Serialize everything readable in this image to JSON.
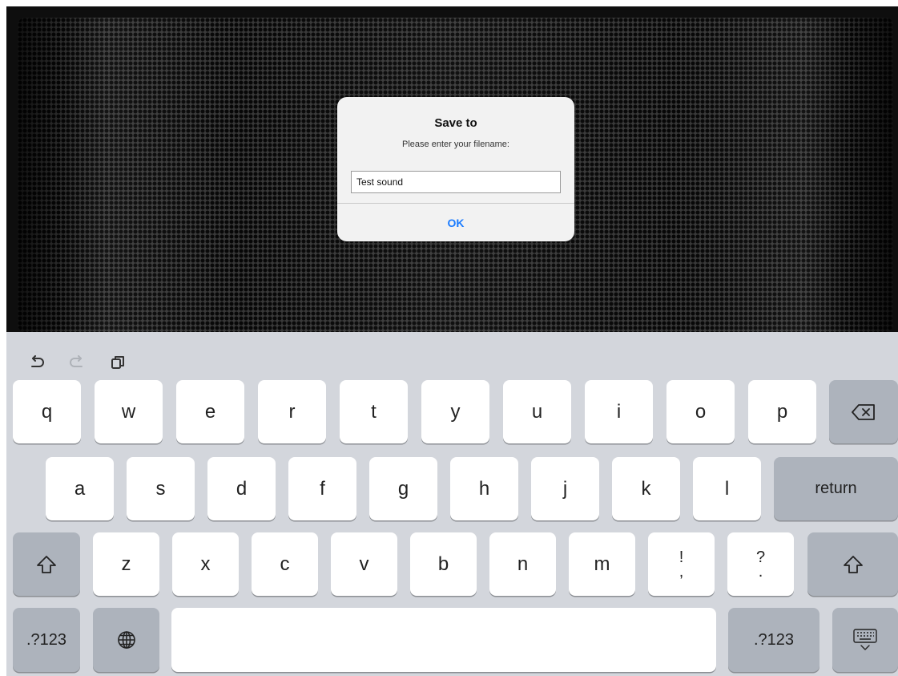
{
  "dialog": {
    "title": "Save to",
    "message": "Please enter your filename:",
    "input_value": "Test sound",
    "ok_label": "OK"
  },
  "keyboard": {
    "toolbar": [
      "undo-icon",
      "redo-icon",
      "paste-icon"
    ],
    "row1": [
      "q",
      "w",
      "e",
      "r",
      "t",
      "y",
      "u",
      "i",
      "o",
      "p"
    ],
    "row2": [
      "a",
      "s",
      "d",
      "f",
      "g",
      "h",
      "j",
      "k",
      "l"
    ],
    "row3": [
      "z",
      "x",
      "c",
      "v",
      "b",
      "n",
      "m"
    ],
    "punct1": {
      "top": "!",
      "bottom": ","
    },
    "punct2": {
      "top": "?",
      "bottom": "."
    },
    "return_label": "return",
    "numbers_label": ".?123",
    "icons": {
      "delete": "delete-icon",
      "shift": "shift-icon",
      "globe": "globe-icon",
      "dismiss": "keyboard-dismiss-icon"
    }
  },
  "colors": {
    "key_light": "#ffffff",
    "key_dark": "#adb3bc",
    "keyboard_bg": "#d3d6dc",
    "accent": "#1a7bff"
  }
}
